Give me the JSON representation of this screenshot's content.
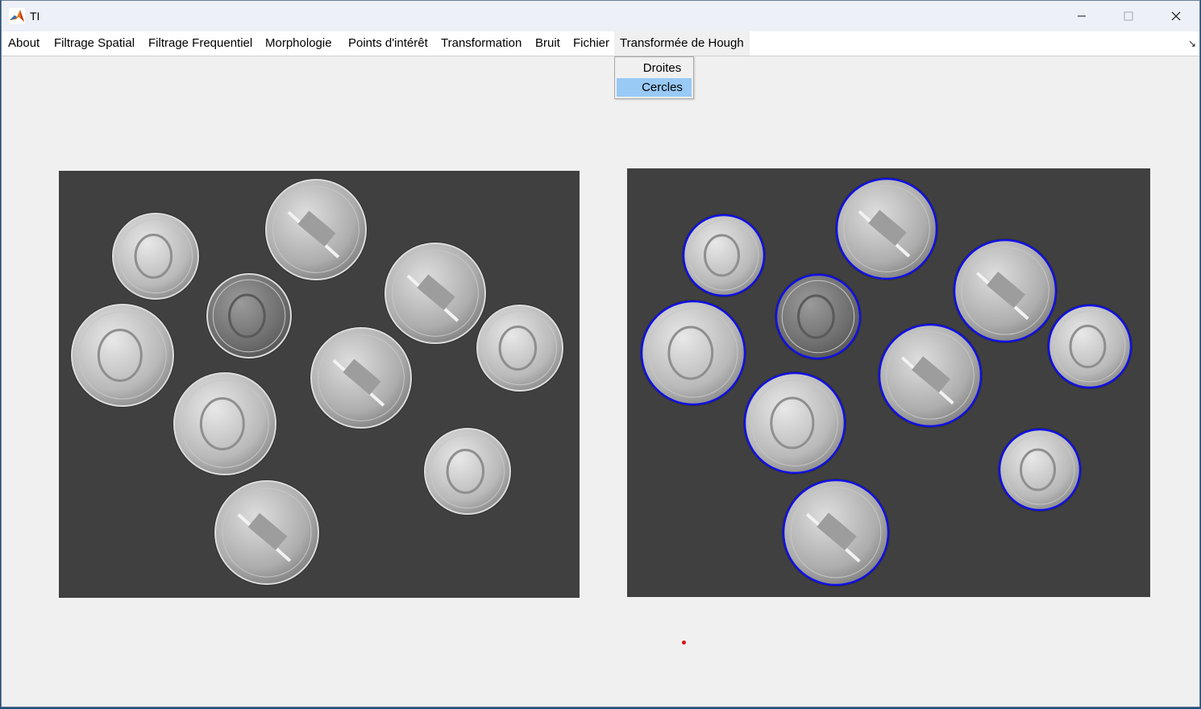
{
  "window": {
    "title": "TI",
    "controls": {
      "minimize": "—",
      "maximize": "☐",
      "close": "✕"
    }
  },
  "menubar": {
    "items": [
      {
        "label": "About"
      },
      {
        "label": "Filtrage Spatial"
      },
      {
        "label": "Filtrage Frequentiel"
      },
      {
        "label": "Morphologie"
      },
      {
        "label": "Points d'intérêt"
      },
      {
        "label": "Transformation"
      },
      {
        "label": "Bruit"
      },
      {
        "label": "Fichier"
      },
      {
        "label": "Transformée de Hough"
      }
    ],
    "overflow_icon": "↘"
  },
  "dropdown": {
    "parent": "Transformée de Hough",
    "items": [
      {
        "label": "Droites",
        "highlighted": false
      },
      {
        "label": "Cercles",
        "highlighted": true
      }
    ]
  },
  "images": {
    "left": {
      "content": "coins-grayscale",
      "coin_count": 10
    },
    "right": {
      "content": "coins-with-detected-circles",
      "circle_color": "#1010e6",
      "circles_detected": 10
    }
  },
  "colors": {
    "highlight": "#99c9f5",
    "axes_background": "#404040",
    "circle_stroke": "#1010e6",
    "marker": "#dd1111"
  }
}
